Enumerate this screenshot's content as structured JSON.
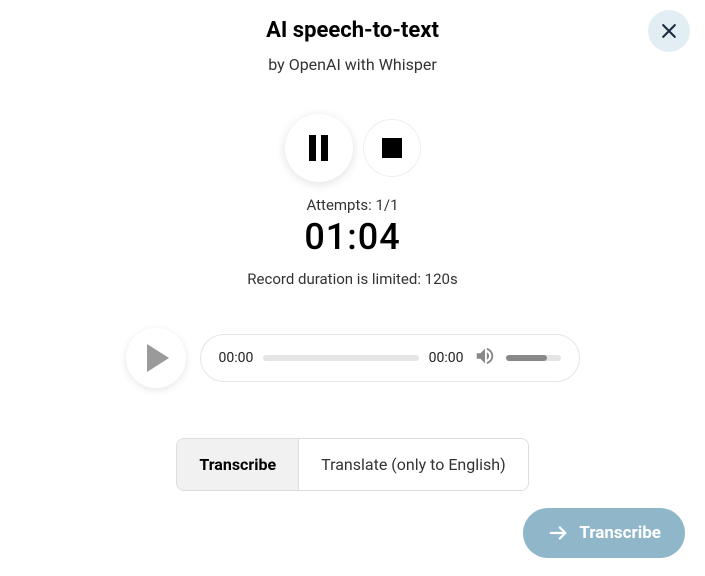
{
  "header": {
    "title": "AI speech-to-text",
    "subtitle": "by OpenAI with Whisper"
  },
  "recorder": {
    "attempts_label": "Attempts: 1/1",
    "timer": "01:04",
    "limit_text": "Record duration is limited: 120s"
  },
  "player": {
    "current_time": "00:00",
    "total_time": "00:00"
  },
  "tabs": {
    "transcribe": "Transcribe",
    "translate": "Translate (only to English)"
  },
  "submit": {
    "label": "Transcribe"
  }
}
